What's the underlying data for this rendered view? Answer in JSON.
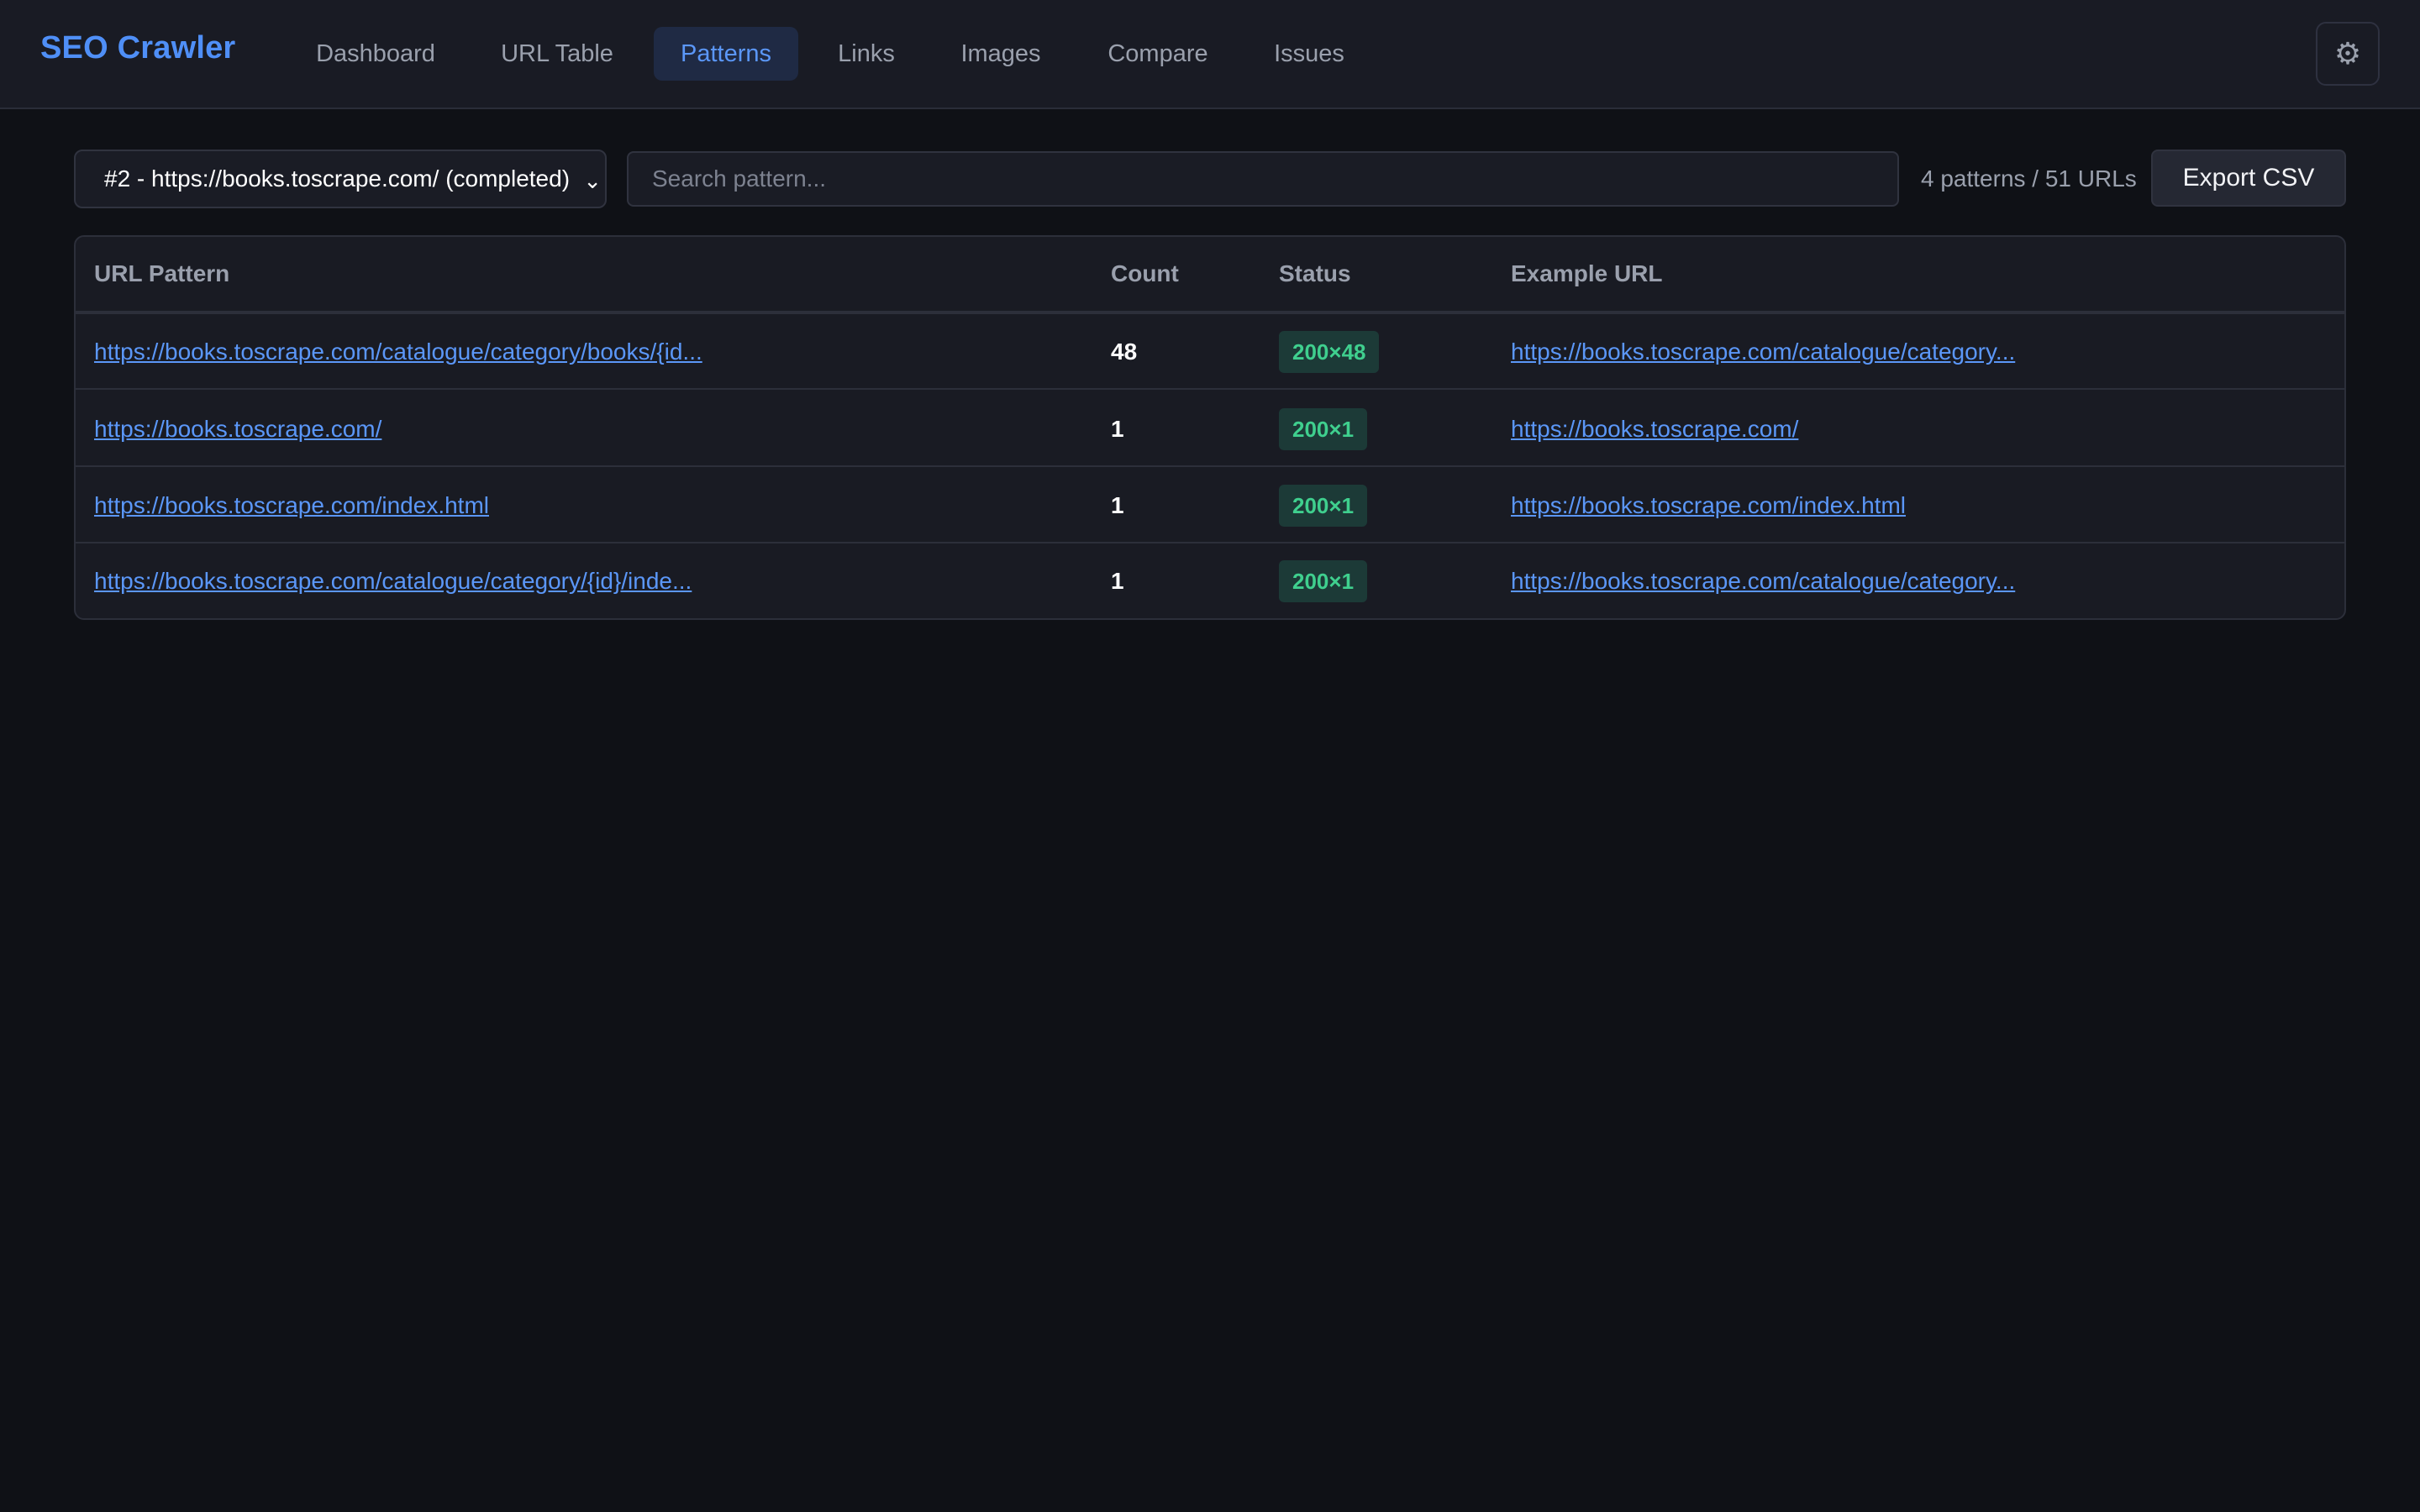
{
  "app": {
    "title": "SEO Crawler"
  },
  "nav": {
    "tabs": [
      {
        "label": "Dashboard",
        "active": false
      },
      {
        "label": "URL Table",
        "active": false
      },
      {
        "label": "Patterns",
        "active": true
      },
      {
        "label": "Links",
        "active": false
      },
      {
        "label": "Images",
        "active": false
      },
      {
        "label": "Compare",
        "active": false
      },
      {
        "label": "Issues",
        "active": false
      }
    ],
    "settings_icon": "gear-icon"
  },
  "toolbar": {
    "run_select_value": "#2 - https://books.toscrape.com/ (completed)",
    "search_placeholder": "Search pattern...",
    "search_value": "",
    "summary": "4 patterns / 51 URLs",
    "export_label": "Export CSV"
  },
  "table": {
    "headers": {
      "pattern": "URL Pattern",
      "count": "Count",
      "status": "Status",
      "example": "Example URL"
    },
    "rows": [
      {
        "pattern": "https://books.toscrape.com/catalogue/category/books/{id...",
        "count": "48",
        "status": "200×48",
        "example": "https://books.toscrape.com/catalogue/category..."
      },
      {
        "pattern": "https://books.toscrape.com/",
        "count": "1",
        "status": "200×1",
        "example": "https://books.toscrape.com/"
      },
      {
        "pattern": "https://books.toscrape.com/index.html",
        "count": "1",
        "status": "200×1",
        "example": "https://books.toscrape.com/index.html"
      },
      {
        "pattern": "https://books.toscrape.com/catalogue/category/{id}/inde...",
        "count": "1",
        "status": "200×1",
        "example": "https://books.toscrape.com/catalogue/category..."
      }
    ]
  },
  "colors": {
    "accent": "#4f8ff7",
    "background": "#0f1116",
    "status_ok_text": "#3fcf8e",
    "status_ok_bg": "#1c3a37"
  }
}
